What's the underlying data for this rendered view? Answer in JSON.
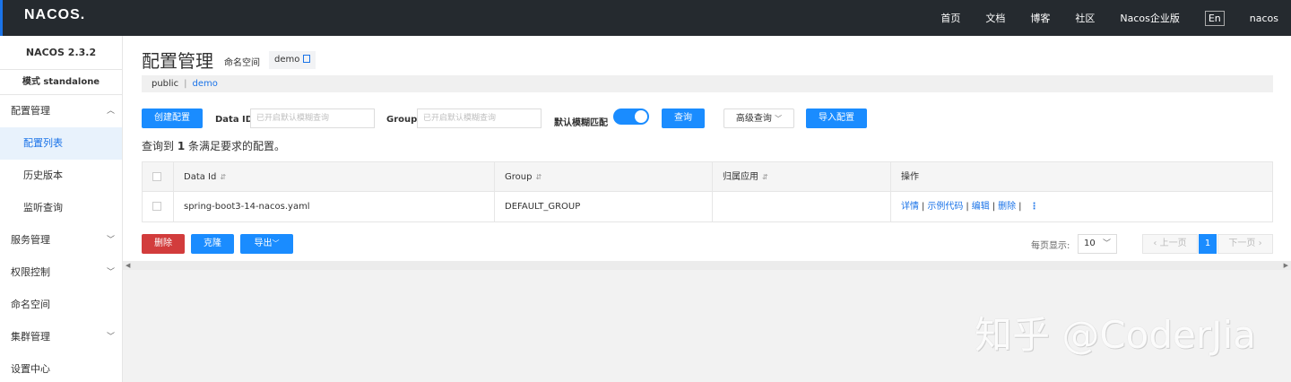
{
  "topbar": {
    "logo": "NACOS.",
    "nav": [
      "首页",
      "文档",
      "博客",
      "社区",
      "Nacos企业版"
    ],
    "lang": "En",
    "user": "nacos"
  },
  "sidebar": {
    "version": "NACOS 2.3.2",
    "mode": "模式 standalone",
    "items": [
      {
        "label": "配置管理"
      },
      {
        "label": "配置列表"
      },
      {
        "label": "历史版本"
      },
      {
        "label": "监听查询"
      },
      {
        "label": "服务管理"
      },
      {
        "label": "权限控制"
      },
      {
        "label": "命名空间"
      },
      {
        "label": "集群管理"
      },
      {
        "label": "设置中心"
      }
    ]
  },
  "header": {
    "title": "配置管理",
    "namespace_label": "命名空间",
    "namespace_value": "demo"
  },
  "breadcrumb": {
    "items": [
      "public",
      "demo"
    ],
    "separator": "|"
  },
  "toolbar": {
    "create_label": "创建配置",
    "dataid_label": "Data ID",
    "dataid_placeholder": "已开启默认模糊查询",
    "group_label": "Group",
    "group_placeholder": "已开启默认模糊查询",
    "fuzzy_label": "默认模糊匹配",
    "fuzzy_on": true,
    "query_label": "查询",
    "advanced_label": "高级查询",
    "import_label": "导入配置"
  },
  "result": {
    "prefix": "查询到",
    "count": "1",
    "suffix": "条满足要求的配置。"
  },
  "table": {
    "columns": [
      "Data Id",
      "Group",
      "归属应用",
      "操作"
    ],
    "rows": [
      {
        "data_id": "spring-boot3-14-nacos.yaml",
        "group": "DEFAULT_GROUP",
        "app": "",
        "ops": [
          "详情",
          "示例代码",
          "编辑",
          "删除"
        ]
      }
    ]
  },
  "footer": {
    "delete_label": "删除",
    "clone_label": "克隆",
    "export_label": "导出",
    "page_size_label": "每页显示:",
    "page_size": "10",
    "prev_label": "上一页",
    "current_page": "1",
    "next_label": "下一页"
  },
  "watermark": "知乎 @CoderJia",
  "colors": {
    "primary": "#1a8cff",
    "danger": "#d23c3c",
    "topbar": "#252a2f",
    "active_bg": "#e8f2fc"
  }
}
